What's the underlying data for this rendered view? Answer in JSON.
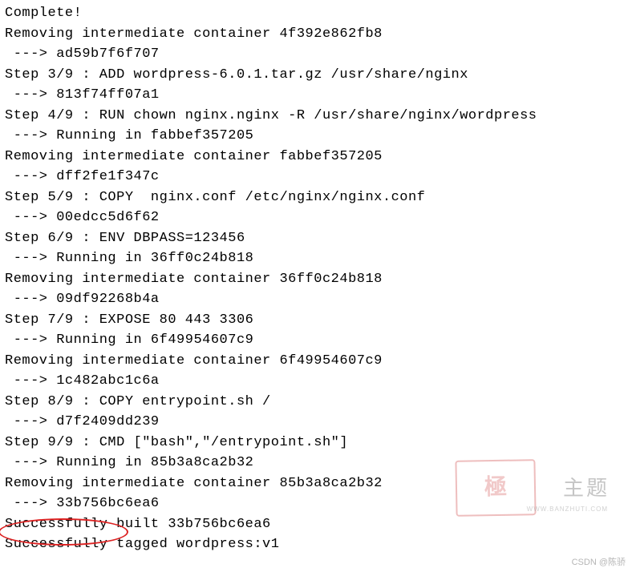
{
  "lines": [
    "Complete!",
    "Removing intermediate container 4f392e862fb8",
    " ---> ad59b7f6f707",
    "Step 3/9 : ADD wordpress-6.0.1.tar.gz /usr/share/nginx",
    " ---> 813f74ff07a1",
    "Step 4/9 : RUN chown nginx.nginx -R /usr/share/nginx/wordpress",
    " ---> Running in fabbef357205",
    "Removing intermediate container fabbef357205",
    " ---> dff2fe1f347c",
    "Step 5/9 : COPY  nginx.conf /etc/nginx/nginx.conf",
    " ---> 00edcc5d6f62",
    "Step 6/9 : ENV DBPASS=123456",
    " ---> Running in 36ff0c24b818",
    "Removing intermediate container 36ff0c24b818",
    " ---> 09df92268b4a",
    "Step 7/9 : EXPOSE 80 443 3306",
    " ---> Running in 6f49954607c9",
    "Removing intermediate container 6f49954607c9",
    " ---> 1c482abc1c6a",
    "Step 8/9 : COPY entrypoint.sh /",
    " ---> d7f2409dd239",
    "Step 9/9 : CMD [\"bash\",\"/entrypoint.sh\"]",
    " ---> Running in 85b3a8ca2b32",
    "Removing intermediate container 85b3a8ca2b32",
    " ---> 33b756bc6ea6",
    "Successfully built 33b756bc6ea6",
    "Successfully tagged wordpress:v1"
  ],
  "watermark": {
    "stamp": "極",
    "text": "主题",
    "url": "WWW.BANZHUTI.COM"
  },
  "csdn": "CSDN @陈骄"
}
